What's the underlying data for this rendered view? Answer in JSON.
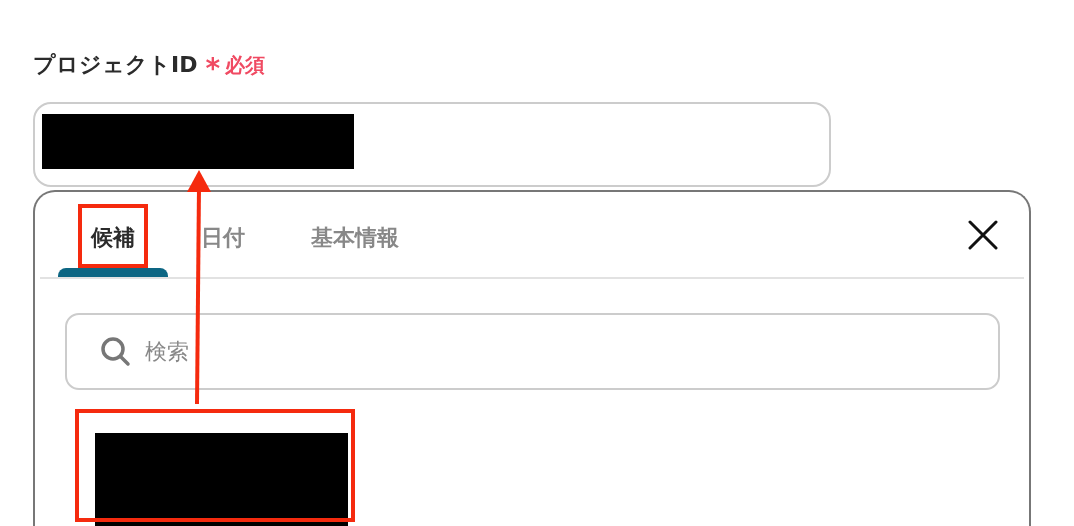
{
  "field": {
    "label": "プロジェクトID",
    "required_mark": "*",
    "required_text": "必須",
    "value_redacted": true
  },
  "picker": {
    "tabs": [
      {
        "label": "候補",
        "selected": true,
        "highlighted": true
      },
      {
        "label": "日付",
        "selected": false,
        "highlighted": false
      },
      {
        "label": "基本情報",
        "selected": false,
        "highlighted": false
      }
    ],
    "search": {
      "placeholder": "検索"
    },
    "candidates": [
      {
        "value_redacted": true,
        "highlighted": true
      }
    ]
  },
  "annotations": {
    "arrow": true
  }
}
